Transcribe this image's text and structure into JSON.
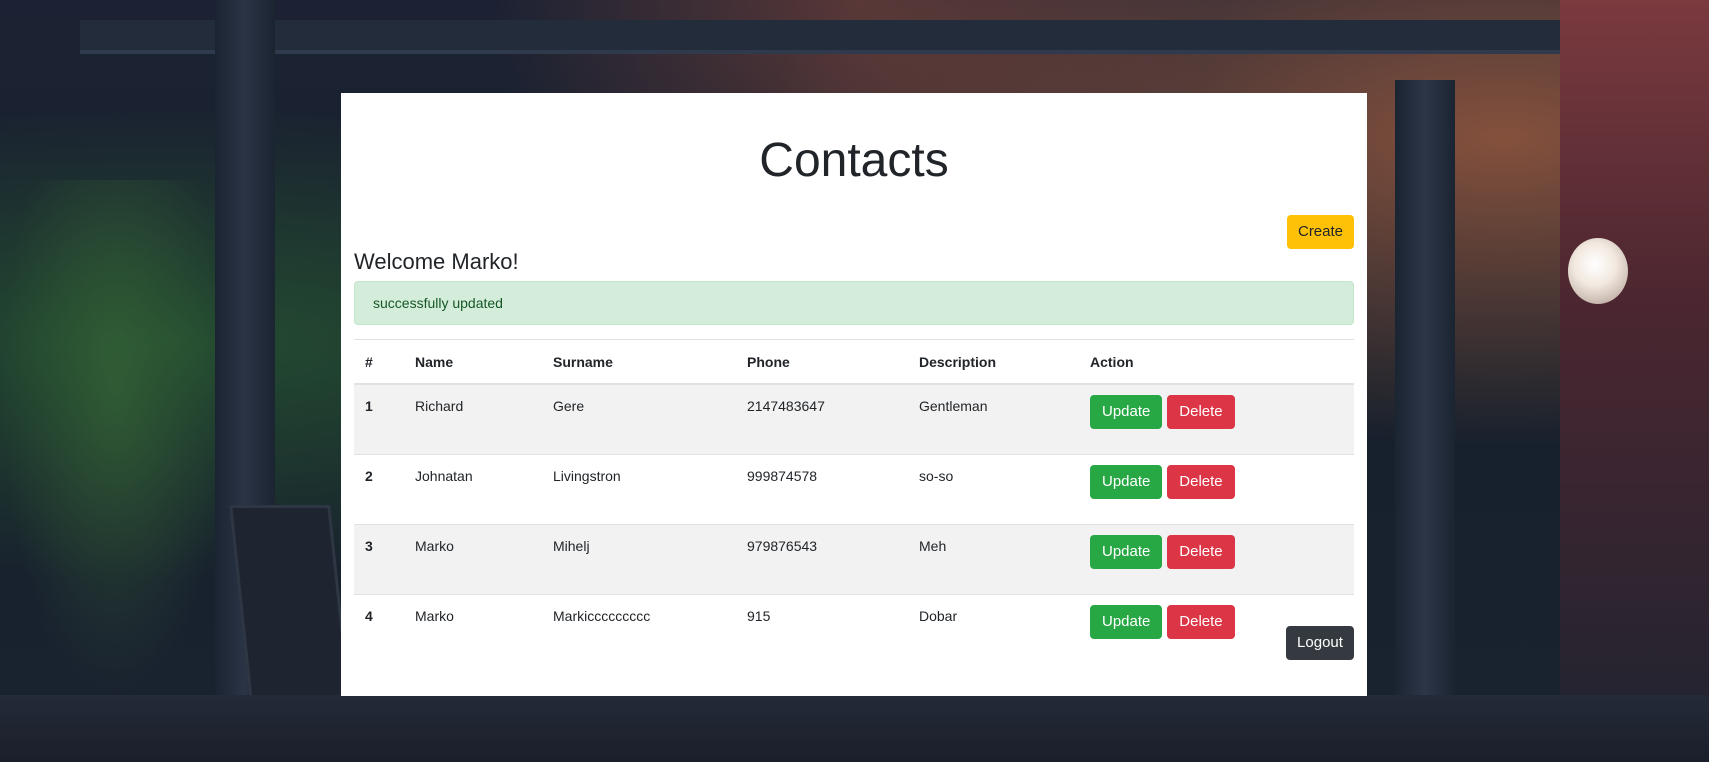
{
  "page": {
    "title": "Contacts",
    "welcome": "Welcome Marko!",
    "create_label": "Create",
    "logout_label": "Logout"
  },
  "alert": {
    "message": "successfully updated",
    "type": "success"
  },
  "table": {
    "headers": [
      "#",
      "Name",
      "Surname",
      "Phone",
      "Description",
      "Action"
    ],
    "rows": [
      {
        "id": "1",
        "name": "Richard",
        "surname": "Gere",
        "phone": "2147483647",
        "description": "Gentleman"
      },
      {
        "id": "2",
        "name": "Johnatan",
        "surname": "Livingstron",
        "phone": "999874578",
        "description": "so-so"
      },
      {
        "id": "3",
        "name": "Marko",
        "surname": "Mihelj",
        "phone": "979876543",
        "description": "Meh"
      },
      {
        "id": "4",
        "name": "Marko",
        "surname": "Markiccccccccc",
        "phone": "915",
        "description": "Dobar"
      }
    ],
    "update_label": "Update",
    "delete_label": "Delete"
  },
  "colors": {
    "create": "#ffc107",
    "update": "#28a745",
    "delete": "#dc3545",
    "logout": "#343a40",
    "alert_bg": "#d4edda",
    "alert_text": "#155724"
  }
}
